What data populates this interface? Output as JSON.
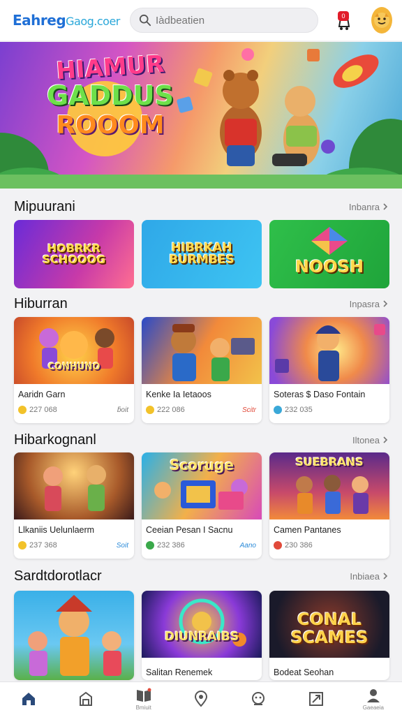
{
  "header": {
    "logo_main": "Eahreg",
    "logo_sub": "Gaog.coer",
    "search_placeholder": "Iàdbeatien",
    "notification_count": "0"
  },
  "hero": {
    "title_line1": "HIAMUR",
    "title_line2": "GADDUS",
    "title_line3": "ROOOM"
  },
  "sections": [
    {
      "title": "Mipuurani",
      "link": "Inbanra",
      "tiles": [
        {
          "text": "HOBRKR SCHOOOG"
        },
        {
          "text": "HIBRKAH BURMBES"
        },
        {
          "text": "NOOSH"
        }
      ]
    },
    {
      "title": "Hiburran",
      "link": "Inpasra",
      "cards": [
        {
          "art_label": "CONHUNO",
          "name": "Aaridn Garn",
          "count": "227 068",
          "tag": "ƃoit"
        },
        {
          "art_label": "",
          "name": "Kenke Ia Ietaoos",
          "count": "222 086",
          "tag": "Scitr"
        },
        {
          "art_label": "",
          "name": "Soteras $ Daso Fontain",
          "count": "232 035",
          "tag": ""
        }
      ]
    },
    {
      "title": "Hibarkognanl",
      "link": "Iltonea",
      "cards": [
        {
          "art_label": "",
          "name": "Llkaniis Uelunlaerm",
          "count": "237 368",
          "tag": "Soit"
        },
        {
          "art_label": "Scoruge",
          "name": "Ceeian Pesan I Sacnu",
          "count": "232 386",
          "tag": "Aano"
        },
        {
          "art_label": "SUEBRANS",
          "name": "Camen Pantanes",
          "count": "230 386",
          "tag": ""
        }
      ]
    },
    {
      "title": "Sardtdorotlacr",
      "link": "Inbiaea",
      "cards": [
        {
          "art_label": "",
          "name": ""
        },
        {
          "art_label": "DIUNRAIBS",
          "name": "Salitan Renemek"
        },
        {
          "art_label": "CONAL SCAMES",
          "name": "Bodeat Seohan"
        }
      ]
    }
  ],
  "bottom_nav": [
    {
      "icon": "home-icon",
      "label": ""
    },
    {
      "icon": "store-icon",
      "label": ""
    },
    {
      "icon": "book-icon",
      "label": "Bmiuit"
    },
    {
      "icon": "location-icon",
      "label": ""
    },
    {
      "icon": "chat-icon",
      "label": ""
    },
    {
      "icon": "puzzle-icon",
      "label": ""
    },
    {
      "icon": "profile-icon",
      "label": "Gaeaeia"
    }
  ],
  "colors": {
    "brand": "#1f6fd6",
    "accent_red": "#e11d2a",
    "avatar": "#f4b63a"
  }
}
